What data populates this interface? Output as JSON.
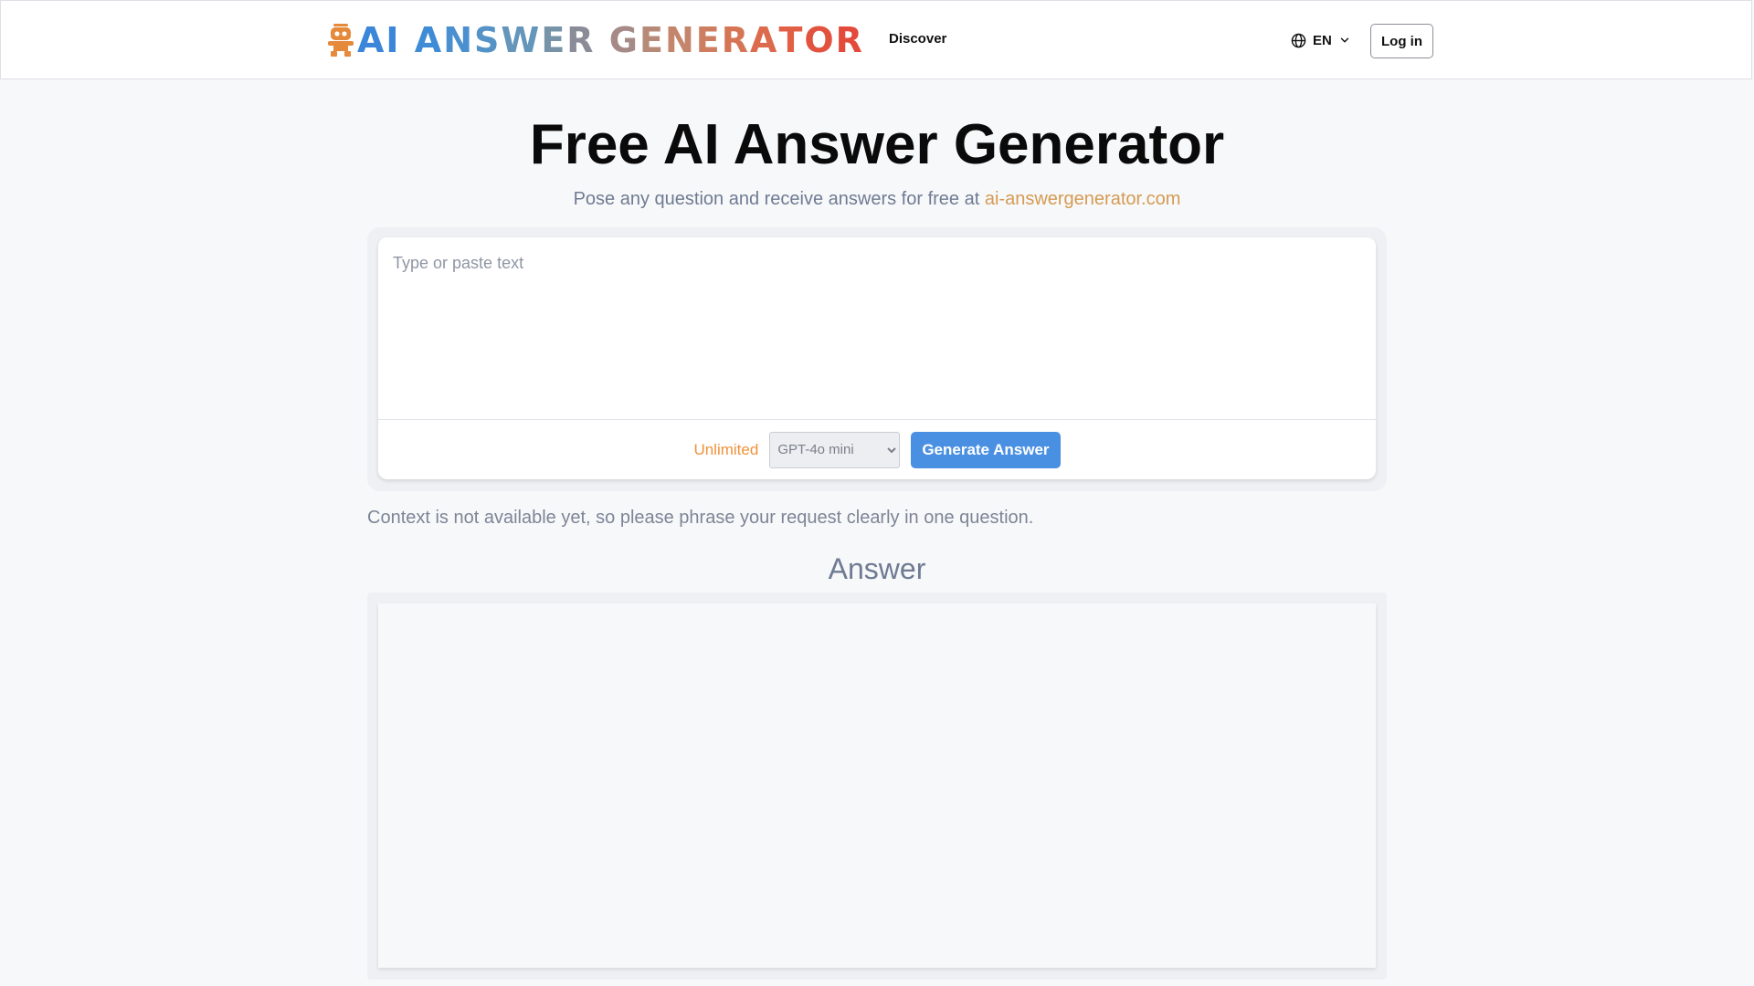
{
  "header": {
    "logo": {
      "letters": [
        {
          "char": "A",
          "color": "#3b86d8"
        },
        {
          "char": "I",
          "color": "#3b86d8"
        },
        {
          "char": " ",
          "color": "#3b86d8"
        },
        {
          "char": "A",
          "color": "#3f8bd6"
        },
        {
          "char": "N",
          "color": "#4a8fd0"
        },
        {
          "char": "S",
          "color": "#5593c6"
        },
        {
          "char": "W",
          "color": "#6396ba"
        },
        {
          "char": "E",
          "color": "#7793a8"
        },
        {
          "char": "R",
          "color": "#8a8c98"
        },
        {
          "char": " ",
          "color": "#8a8c98"
        },
        {
          "char": "G",
          "color": "#a58a87"
        },
        {
          "char": "E",
          "color": "#b78a78"
        },
        {
          "char": "N",
          "color": "#c4856c"
        },
        {
          "char": "E",
          "color": "#cd7e60"
        },
        {
          "char": "R",
          "color": "#d57556"
        },
        {
          "char": "A",
          "color": "#dc6a4c"
        },
        {
          "char": "T",
          "color": "#e05f45"
        },
        {
          "char": "O",
          "color": "#e2533f"
        },
        {
          "char": "R",
          "color": "#e34a3b"
        }
      ],
      "icon": "robot-icon",
      "icon_color": "#e5893a"
    },
    "nav_discover": "Discover",
    "language": {
      "label": "EN",
      "icon": "globe-icon",
      "chevron": "chevron-down-icon"
    },
    "login_label": "Log in"
  },
  "hero": {
    "title": "Free AI Answer Generator",
    "subtitle_prefix": "Pose any question and receive answers for free at ",
    "subtitle_link": "ai-answergenerator.com"
  },
  "input": {
    "placeholder": "Type or paste text",
    "value": "",
    "unlimited_label": "Unlimited",
    "model_select": {
      "selected": "GPT-4o mini",
      "options": [
        "GPT-4o mini"
      ]
    },
    "generate_label": "Generate Answer"
  },
  "context_note": "Context is not available yet, so please phrase your request clearly in one question.",
  "answer": {
    "heading": "Answer",
    "content": ""
  },
  "colors": {
    "accent_blue": "#4a90e2",
    "unlimited_orange": "#f0913a",
    "link_gold": "#d59a52",
    "muted_text": "#6f7b92"
  }
}
